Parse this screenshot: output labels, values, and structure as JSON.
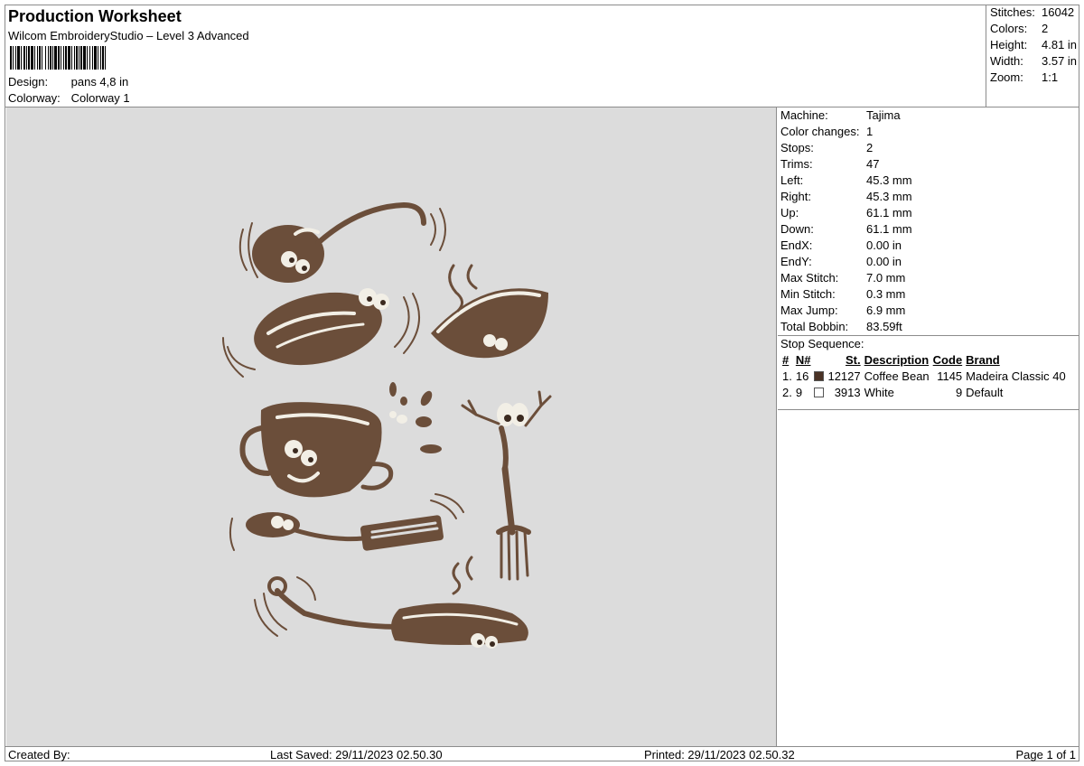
{
  "header": {
    "title": "Production Worksheet",
    "subtitle": "Wilcom EmbroideryStudio – Level 3 Advanced",
    "design_label": "Design:",
    "design_value": "pans 4,8 in",
    "colorway_label": "Colorway:",
    "colorway_value": "Colorway 1"
  },
  "summary": [
    {
      "label": "Stitches:",
      "value": "16042"
    },
    {
      "label": "Colors:",
      "value": "2"
    },
    {
      "label": "Height:",
      "value": "4.81 in"
    },
    {
      "label": "Width:",
      "value": "3.57 in"
    },
    {
      "label": "Zoom:",
      "value": "1:1"
    }
  ],
  "machine_info": [
    {
      "label": "Machine:",
      "value": "Tajima"
    },
    {
      "label": "Color changes:",
      "value": "1"
    },
    {
      "label": "Stops:",
      "value": "2"
    },
    {
      "label": "Trims:",
      "value": "47"
    },
    {
      "label": "Left:",
      "value": "45.3 mm"
    },
    {
      "label": "Right:",
      "value": "45.3 mm"
    },
    {
      "label": "Up:",
      "value": "61.1 mm"
    },
    {
      "label": "Down:",
      "value": "61.1 mm"
    },
    {
      "label": "EndX:",
      "value": "0.00 in"
    },
    {
      "label": "EndY:",
      "value": "0.00 in"
    },
    {
      "label": "Max Stitch:",
      "value": "7.0 mm"
    },
    {
      "label": "Min Stitch:",
      "value": "0.3 mm"
    },
    {
      "label": "Max Jump:",
      "value": "6.9 mm"
    },
    {
      "label": "Total Bobbin:",
      "value": "83.59ft"
    }
  ],
  "stop_sequence": {
    "label": "Stop Sequence:",
    "columns": [
      "#",
      "N#",
      "St.",
      "Description",
      "Code",
      "Brand"
    ],
    "rows": [
      {
        "num": "1.",
        "n": "16",
        "color": "#4a3225",
        "stitches": "12127",
        "description": "Coffee Bean",
        "code": "1145",
        "brand": "Madeira Classic 40"
      },
      {
        "num": "2.",
        "n": "9",
        "color": "#ffffff",
        "stitches": "3913",
        "description": "White",
        "code": "9",
        "brand": "Default"
      }
    ]
  },
  "footer": {
    "created_by": "Created By:",
    "last_saved": "Last Saved: 29/11/2023 02.50.30",
    "printed": "Printed: 29/11/2023 02.50.32",
    "page": "Page 1 of 1"
  },
  "colors": {
    "thread_brown": "#6b4e3a",
    "thread_white": "#f2efe6",
    "canvas": "#dcdcdc"
  }
}
